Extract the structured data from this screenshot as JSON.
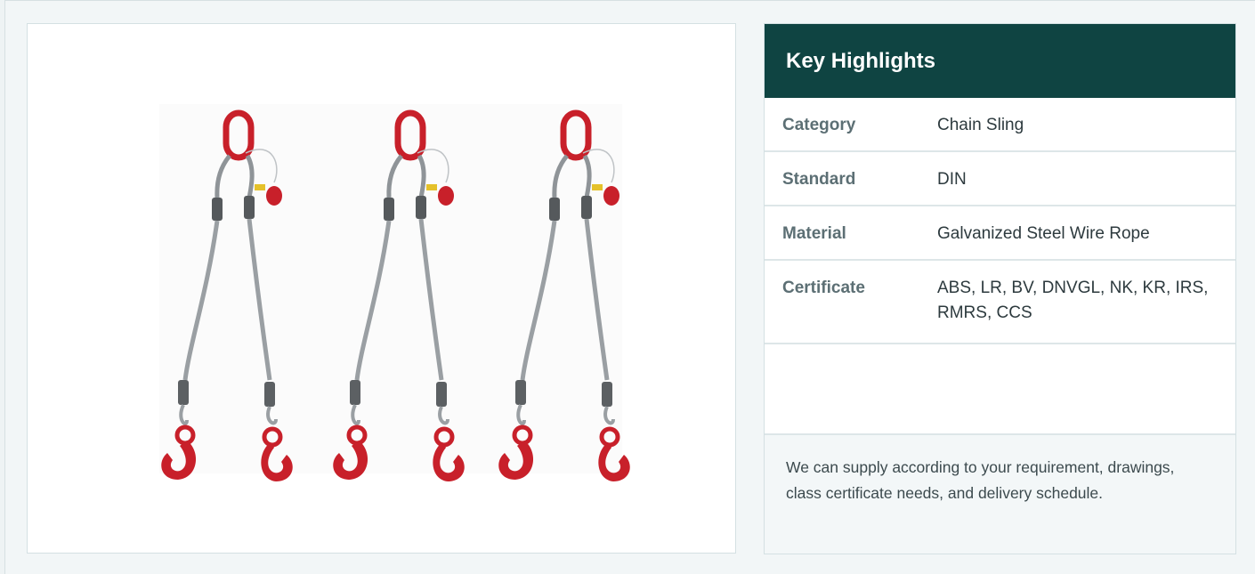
{
  "product_image": {
    "alt": "three two-leg wire rope slings with red master links and hooks",
    "count": 3
  },
  "highlights": {
    "title": "Key Highlights",
    "rows": [
      {
        "label": "Category",
        "value": "Chain Sling"
      },
      {
        "label": "Standard",
        "value": "DIN"
      },
      {
        "label": "Material",
        "value": "Galvanized Steel Wire Rope"
      },
      {
        "label": "Certificate",
        "value": "ABS, LR, BV, DNVGL, NK, KR, IRS, RMRS, CCS"
      }
    ],
    "note": "We can supply according to your requirement, drawings, class certificate needs, and delivery schedule."
  },
  "colors": {
    "header_bg": "#0f4442",
    "hook_red": "#c8202a",
    "rope_grey": "#9a9fa3"
  }
}
